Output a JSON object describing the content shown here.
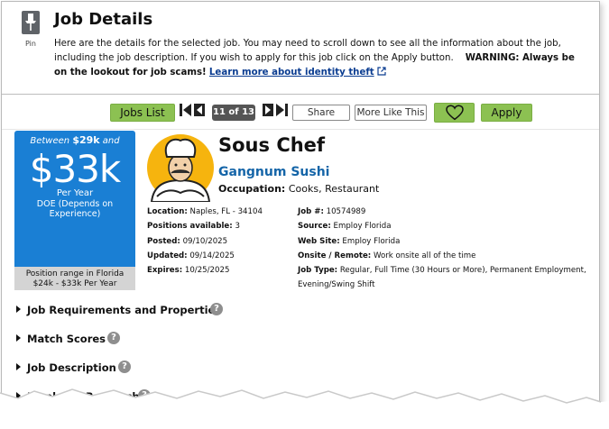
{
  "header": {
    "pin_label": "Pin",
    "title": "Job Details",
    "description": "Here are the details for the selected job. You may need to scroll down to see all the information about the job, including the job description. If you wish to apply for this job click on the Apply button.",
    "warning": "WARNING: Always be on the lookout for job scams!",
    "learn_more": "Learn more about identity theft"
  },
  "toolbar": {
    "jobs_list": "Jobs List",
    "counter": "11 of 13",
    "share": "Share",
    "more_like_this": "More Like This",
    "apply": "Apply"
  },
  "salary": {
    "between_prefix": "Between",
    "low": "$29k",
    "and": "and",
    "amount": "$33k",
    "per": "Per Year",
    "doe": "DOE (Depends on Experience)",
    "range_line1": "Position range in Florida",
    "range_line2": "$24k - $33k Per Year"
  },
  "job": {
    "title": "Sous Chef",
    "company": "Gangnum Sushi",
    "occupation_label": "Occupation:",
    "occupation": "Cooks, Restaurant"
  },
  "facts_left": [
    {
      "label": "Location:",
      "value": "Naples, FL - 34104"
    },
    {
      "label": "Positions available:",
      "value": "3"
    },
    {
      "label": "Posted:",
      "value": "09/10/2025"
    },
    {
      "label": "Updated:",
      "value": "09/14/2025"
    },
    {
      "label": "Expires:",
      "value": "10/25/2025"
    }
  ],
  "facts_right": [
    {
      "label": "Job #:",
      "value": "10574989"
    },
    {
      "label": "Source:",
      "value": "Employ Florida"
    },
    {
      "label": "Web Site:",
      "value": "Employ Florida"
    },
    {
      "label": "Onsite / Remote:",
      "value": "Work onsite all of the time"
    },
    {
      "label": "Job Type:",
      "value": "Regular, Full Time (30 Hours or More), Permanent Employment, Evening/Swing Shift"
    }
  ],
  "sections": [
    {
      "label": "Job Requirements and Properties"
    },
    {
      "label": "Match Scores"
    },
    {
      "label": "Job Description"
    },
    {
      "label": "Employer Research"
    }
  ],
  "help_glyph": "?",
  "colors": {
    "green_button": "#8cc152",
    "salary_blue": "#1a7fd4",
    "company_blue": "#1565a8",
    "link_blue": "#0b3d91"
  },
  "icons": [
    "pin-icon",
    "external-link-icon",
    "first-page-icon",
    "previous-icon",
    "next-icon",
    "last-page-icon",
    "heart-icon",
    "help-icon",
    "expand-triangle-icon",
    "chef-avatar"
  ]
}
